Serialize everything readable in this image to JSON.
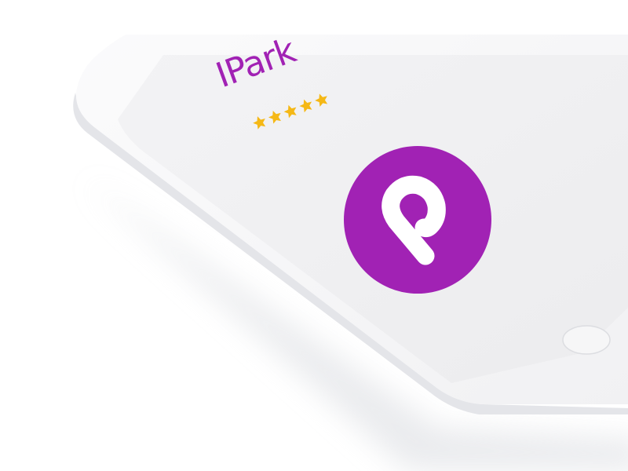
{
  "app": {
    "title": "IPark",
    "rating": 5,
    "rating_max": 5,
    "logo_icon": "parking-pin-logo-icon"
  },
  "device": {
    "home_button_icon": "home-button-icon"
  },
  "colors": {
    "brand": "#a122b4",
    "star": "#f5b816",
    "screen": "#efeff1",
    "device_body": "#f7f7f8"
  }
}
